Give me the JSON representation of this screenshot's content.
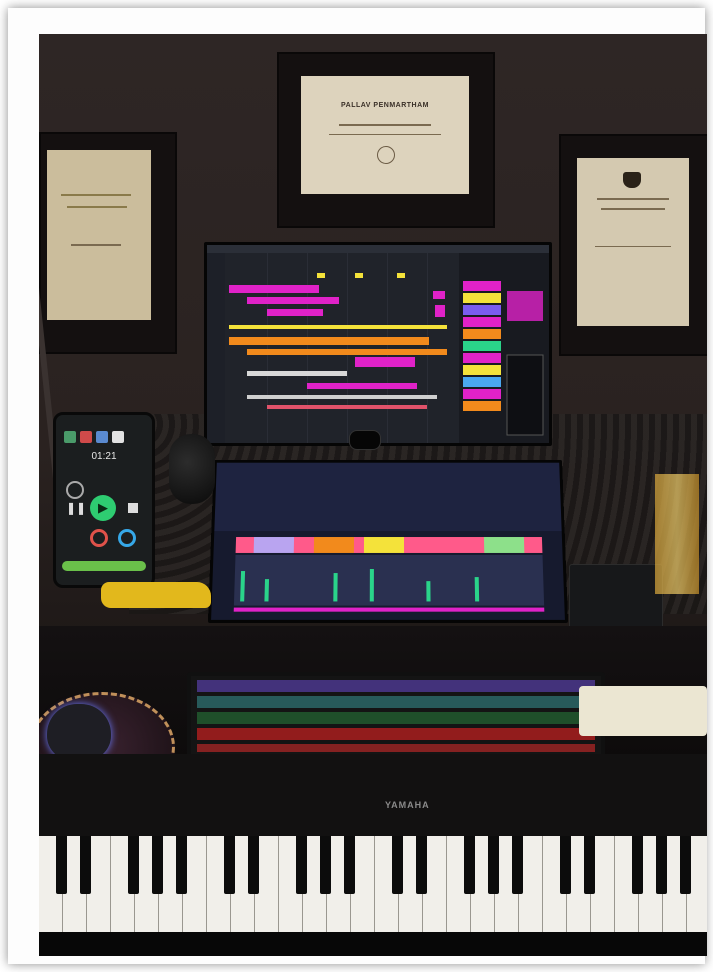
{
  "scene": {
    "subject": "music-production-studio-desk",
    "colors": {
      "wall": "#2e2625",
      "daw_magenta": "#e022c8",
      "daw_yellow": "#f4e23a",
      "daw_orange": "#f28a1c",
      "mixer_green": "#2ad48a",
      "phone_green": "#2ecc71"
    }
  },
  "certificates": {
    "center_title": "PALLAV PENMARTHAM"
  },
  "keyboard": {
    "brand": "YAMAHA"
  },
  "phone": {
    "time_readout": "01:21"
  },
  "icons": [
    "record-icon",
    "play-icon",
    "loop-icon",
    "pause-icon",
    "stop-icon",
    "mouse-icon"
  ]
}
